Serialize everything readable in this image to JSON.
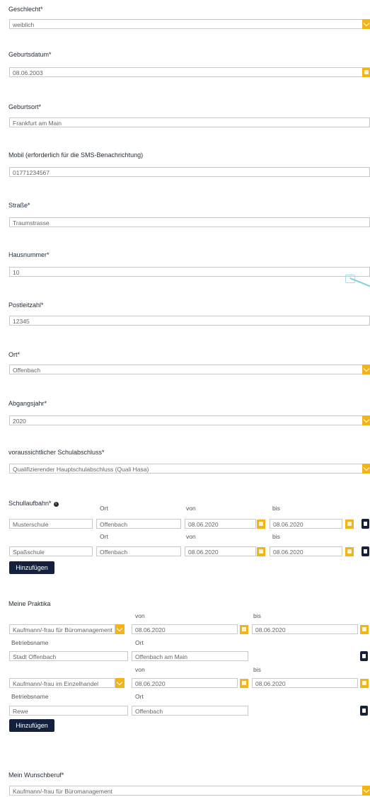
{
  "geschlecht": {
    "label": "Geschlecht*",
    "value": "weiblich"
  },
  "geburtsdatum": {
    "label": "Geburtsdatum*",
    "value": "08.06.2003"
  },
  "geburtsort": {
    "label": "Geburtsort*",
    "value": "Frankfurt am Main"
  },
  "mobil": {
    "label": "Mobil (erforderlich für die SMS-Benachrichtung)",
    "value": "01771234567"
  },
  "strasse": {
    "label": "Straße*",
    "value": "Traumstrasse"
  },
  "hausnummer": {
    "label": "Hausnummer*",
    "value": "10"
  },
  "plz": {
    "label": "Postleitzahl*",
    "value": "12345"
  },
  "ort": {
    "label": "Ort*",
    "value": "Offenbach"
  },
  "abgangsjahr": {
    "label": "Abgangsjahr*",
    "value": "2020"
  },
  "schulabschluss": {
    "label": "voraussichtlicher Schulabschluss*",
    "value": "Qualifizierender Hauptschulabschluss (Quali Hasa)"
  },
  "schullaufbahn": {
    "label": "Schullaufbahn*",
    "col_ort": "Ort",
    "col_von": "von",
    "col_bis": "bis",
    "rows": [
      {
        "schule": "Musterschule",
        "ort": "Offenbach",
        "von": "08.06.2020",
        "bis": "08.06.2020"
      },
      {
        "schule": "Spaßschule",
        "ort": "Offenbach",
        "von": "08.06.2020",
        "bis": "08.06.2020"
      }
    ],
    "add_label": "Hinzufügen"
  },
  "praktika": {
    "label": "Meine Praktika",
    "col_von": "von",
    "col_bis": "bis",
    "col_betrieb": "Betriebsname",
    "col_ort": "Ort",
    "rows": [
      {
        "beruf": "Kaufmann/-frau für Büromanagement",
        "von": "08.06.2020",
        "bis": "08.06.2020",
        "betrieb": "Stadt Offenbach",
        "ort": "Offenbach am Main"
      },
      {
        "beruf": "Kaufmann/-frau im Einzelhandel",
        "von": "08.06.2020",
        "bis": "08.06.2020",
        "betrieb": "Rewe",
        "ort": "Offenbach"
      }
    ],
    "add_label": "Hinzufügen"
  },
  "wunschberuf": {
    "label": "Mein Wunschberuf*",
    "value": "Kaufmann/-frau für Büromanagement"
  }
}
